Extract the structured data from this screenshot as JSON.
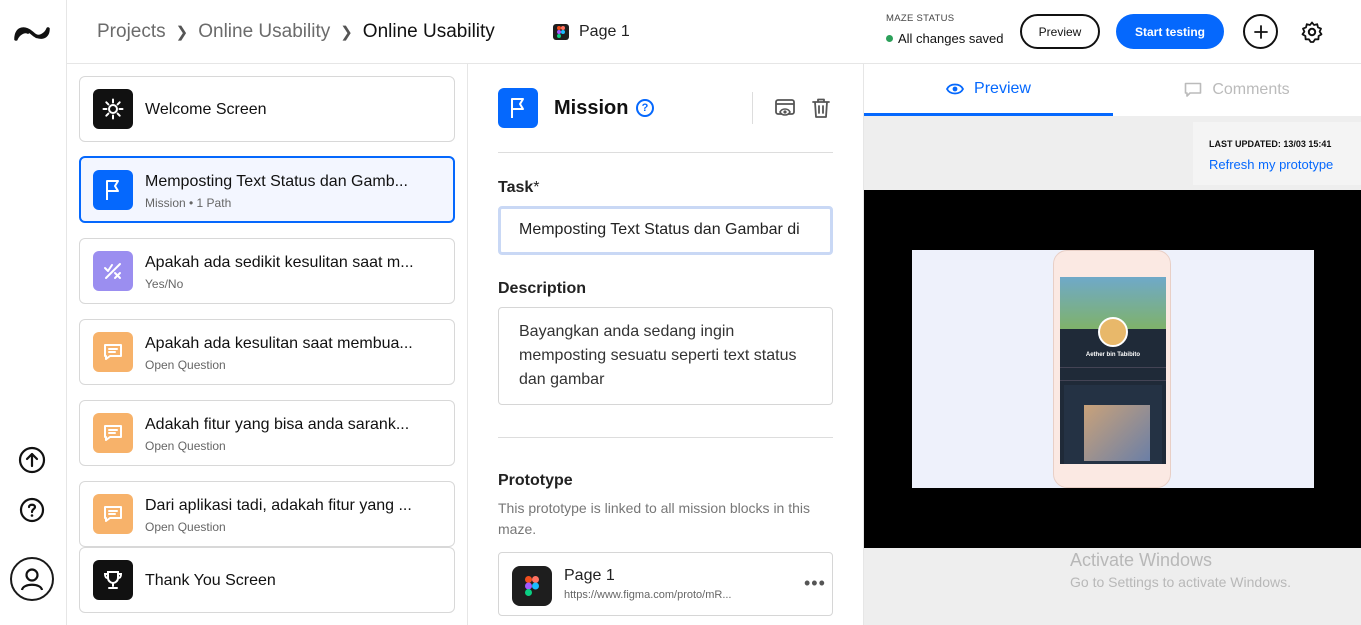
{
  "header": {
    "breadcrumbs": [
      "Projects",
      "Online Usability",
      "Online Usability"
    ],
    "page_chip": "Page 1",
    "status_label": "MAZE STATUS",
    "status_value": "All changes saved",
    "preview_label": "Preview",
    "start_label": "Start testing"
  },
  "blocks": [
    {
      "title": "Welcome Screen",
      "subtitle": "",
      "icon": "sun-icon",
      "color": "#111111"
    },
    {
      "title": "Memposting Text Status dan Gamb...",
      "subtitle": "Mission • 1 Path",
      "icon": "flag-icon",
      "color": "#0568fd",
      "selected": true
    },
    {
      "title": "Apakah ada sedikit kesulitan saat m...",
      "subtitle": "Yes/No",
      "icon": "yes-no-icon",
      "color": "#9b8ef0"
    },
    {
      "title": "Apakah ada kesulitan saat membua...",
      "subtitle": "Open Question",
      "icon": "message-icon",
      "color": "#f7b26a"
    },
    {
      "title": "Adakah fitur yang bisa anda sarank...",
      "subtitle": "Open Question",
      "icon": "message-icon",
      "color": "#f7b26a"
    },
    {
      "title": "Dari aplikasi tadi, adakah fitur yang ...",
      "subtitle": "Open Question",
      "icon": "message-icon",
      "color": "#f7b26a"
    },
    {
      "title": "Thank You Screen",
      "subtitle": "",
      "icon": "trophy-icon",
      "color": "#111111"
    }
  ],
  "editor": {
    "title": "Mission",
    "task_label": "Task",
    "task_required_mark": "*",
    "task_value": "Memposting Text Status dan Gambar di",
    "description_label": "Description",
    "description_value": "Bayangkan anda sedang ingin memposting sesuatu seperti text status dan gambar",
    "prototype_label": "Prototype",
    "prototype_note": "This prototype is linked to all mission blocks in this maze.",
    "prototype_name": "Page 1",
    "prototype_url": "https://www.figma.com/proto/mR...",
    "prototype_more": "•••"
  },
  "preview_panel": {
    "tab_preview": "Preview",
    "tab_comments": "Comments",
    "last_updated": "LAST UPDATED: 13/03 15:41",
    "refresh": "Refresh my prototype",
    "profile_name": "Aether bin Tabibito"
  },
  "watermark": {
    "line1": "Activate Windows",
    "line2": "Go to Settings to activate Windows."
  },
  "colors": {
    "accent": "#0568fd",
    "success": "#2ca05a"
  }
}
